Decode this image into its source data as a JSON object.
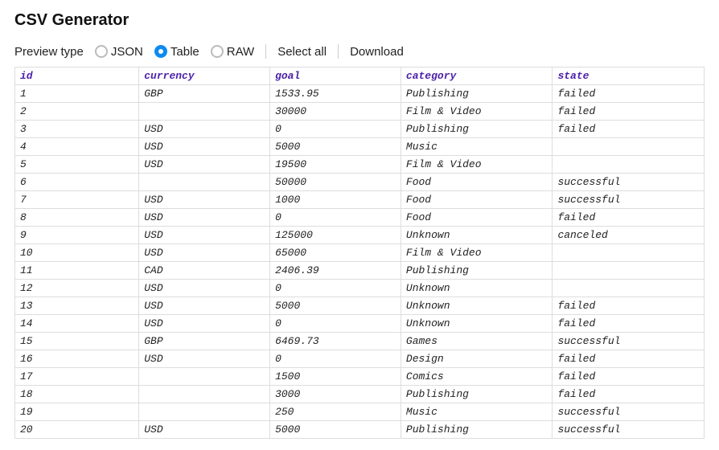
{
  "title": "CSV Generator",
  "toolbar": {
    "preview_label": "Preview type",
    "options": {
      "json": "JSON",
      "table": "Table",
      "raw": "RAW"
    },
    "selected": "table",
    "select_all": "Select all",
    "download": "Download"
  },
  "table": {
    "columns": [
      "id",
      "currency",
      "goal",
      "category",
      "state"
    ],
    "rows": [
      {
        "id": "1",
        "currency": "GBP",
        "goal": "1533.95",
        "category": "Publishing",
        "state": "failed"
      },
      {
        "id": "2",
        "currency": "",
        "goal": "30000",
        "category": "Film & Video",
        "state": "failed"
      },
      {
        "id": "3",
        "currency": "USD",
        "goal": "0",
        "category": "Publishing",
        "state": "failed"
      },
      {
        "id": "4",
        "currency": "USD",
        "goal": "5000",
        "category": "Music",
        "state": ""
      },
      {
        "id": "5",
        "currency": "USD",
        "goal": "19500",
        "category": "Film & Video",
        "state": ""
      },
      {
        "id": "6",
        "currency": "",
        "goal": "50000",
        "category": "Food",
        "state": "successful"
      },
      {
        "id": "7",
        "currency": "USD",
        "goal": "1000",
        "category": "Food",
        "state": "successful"
      },
      {
        "id": "8",
        "currency": "USD",
        "goal": "0",
        "category": "Food",
        "state": "failed"
      },
      {
        "id": "9",
        "currency": "USD",
        "goal": "125000",
        "category": "Unknown",
        "state": "canceled"
      },
      {
        "id": "10",
        "currency": "USD",
        "goal": "65000",
        "category": "Film & Video",
        "state": ""
      },
      {
        "id": "11",
        "currency": "CAD",
        "goal": "2406.39",
        "category": "Publishing",
        "state": ""
      },
      {
        "id": "12",
        "currency": "USD",
        "goal": "0",
        "category": "Unknown",
        "state": ""
      },
      {
        "id": "13",
        "currency": "USD",
        "goal": "5000",
        "category": "Unknown",
        "state": "failed"
      },
      {
        "id": "14",
        "currency": "USD",
        "goal": "0",
        "category": "Unknown",
        "state": "failed"
      },
      {
        "id": "15",
        "currency": "GBP",
        "goal": "6469.73",
        "category": "Games",
        "state": "successful"
      },
      {
        "id": "16",
        "currency": "USD",
        "goal": "0",
        "category": "Design",
        "state": "failed"
      },
      {
        "id": "17",
        "currency": "",
        "goal": "1500",
        "category": "Comics",
        "state": "failed"
      },
      {
        "id": "18",
        "currency": "",
        "goal": "3000",
        "category": "Publishing",
        "state": "failed"
      },
      {
        "id": "19",
        "currency": "",
        "goal": "250",
        "category": "Music",
        "state": "successful"
      },
      {
        "id": "20",
        "currency": "USD",
        "goal": "5000",
        "category": "Publishing",
        "state": "successful"
      }
    ]
  }
}
